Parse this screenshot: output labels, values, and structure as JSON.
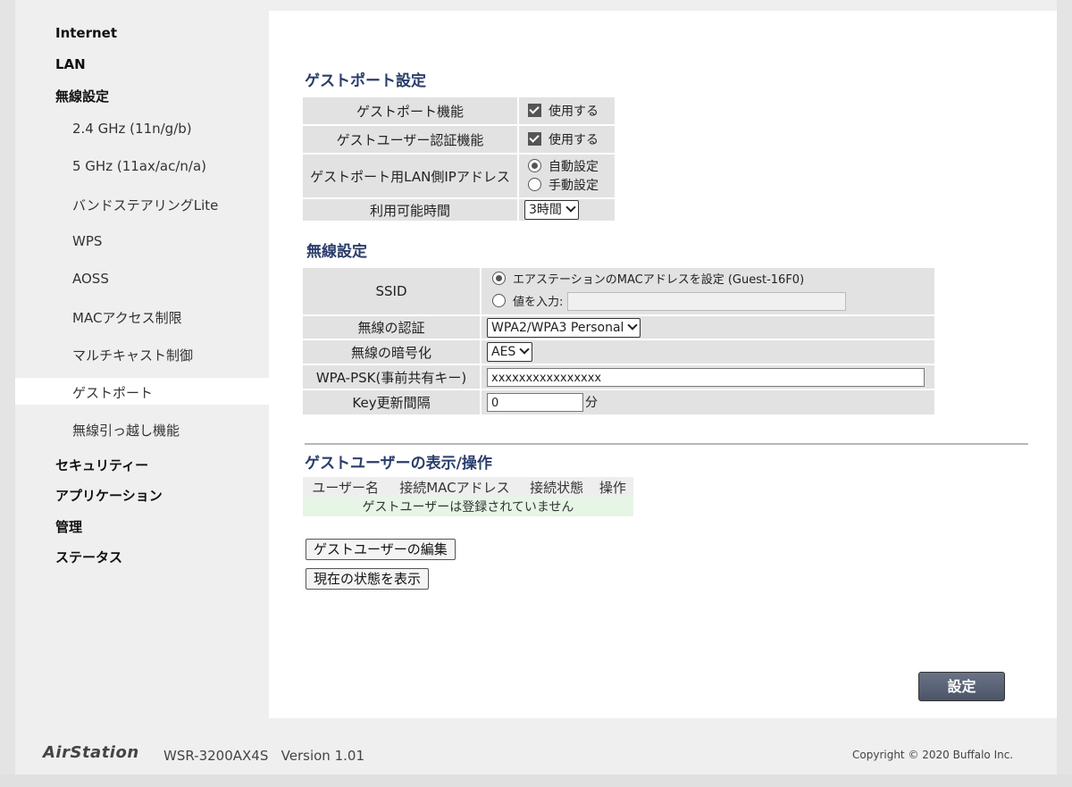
{
  "sidebar": {
    "items": [
      {
        "label": "Internet"
      },
      {
        "label": "LAN"
      },
      {
        "label": "無線設定"
      },
      {
        "label": "2.4 GHz (11n/g/b)"
      },
      {
        "label": "5 GHz (11ax/ac/n/a)"
      },
      {
        "label": "バンドステアリングLite"
      },
      {
        "label": "WPS"
      },
      {
        "label": "AOSS"
      },
      {
        "label": "MACアクセス制限"
      },
      {
        "label": "マルチキャスト制御"
      },
      {
        "label": "ゲストポート"
      },
      {
        "label": "無線引っ越し機能"
      },
      {
        "label": "セキュリティー"
      },
      {
        "label": "アプリケーション"
      },
      {
        "label": "管理"
      },
      {
        "label": "ステータス"
      }
    ],
    "active": "ゲストポート"
  },
  "guest_port": {
    "title": "ゲストポート設定",
    "feature_label": "ゲストポート機能",
    "feature_value": "使用する",
    "auth_label": "ゲストユーザー認証機能",
    "auth_value": "使用する",
    "ip_label": "ゲストポート用LAN側IPアドレス",
    "ip_auto": "自動設定",
    "ip_manual": "手動設定",
    "time_label": "利用可能時間",
    "time_value": "3時間"
  },
  "wireless": {
    "title": "無線設定",
    "ssid_label": "SSID",
    "ssid_mac_option": "エアステーションのMACアドレスを設定 (Guest-16F0)",
    "ssid_input_option": "値を入力:",
    "auth_label": "無線の認証",
    "auth_value": "WPA2/WPA3 Personal",
    "enc_label": "無線の暗号化",
    "enc_value": "AES",
    "psk_label": "WPA-PSK(事前共有キー)",
    "psk_value": "xxxxxxxxxxxxxxxx",
    "key_label": "Key更新間隔",
    "key_value": "0",
    "key_unit": "分"
  },
  "guest_users": {
    "title": "ゲストユーザーの表示/操作",
    "columns": [
      "ユーザー名",
      "接続MACアドレス",
      "接続状態",
      "操作"
    ],
    "empty_message": "ゲストユーザーは登録されていません",
    "edit_button": "ゲストユーザーの編集",
    "status_button": "現在の状態を表示"
  },
  "submit_label": "設定",
  "footer": {
    "brand": "AirStation",
    "model": "WSR-3200AX4S   Version 1.01",
    "copyright": "Copyright © 2020 Buffalo Inc."
  }
}
